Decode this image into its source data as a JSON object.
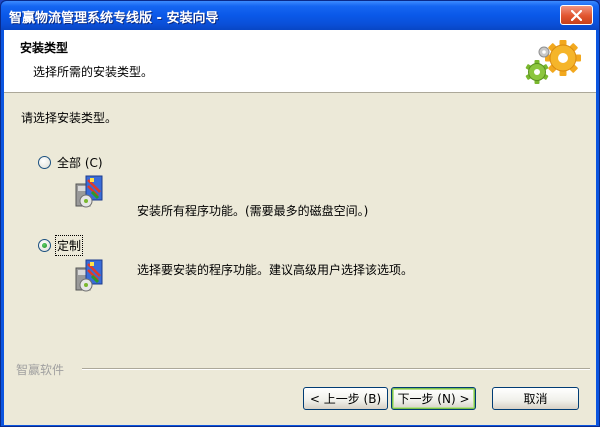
{
  "window": {
    "title": "智赢物流管理系统专线版 - 安装向导"
  },
  "header": {
    "title": "安装类型",
    "subtitle": "选择所需的安装类型。",
    "icon": "gears-icon"
  },
  "body": {
    "prompt": "请选择安装类型。",
    "options": [
      {
        "label": "全部 (C)",
        "selected": false,
        "description": "安装所有程序功能。(需要最多的磁盘空间。)",
        "icon": "package-icon"
      },
      {
        "label": "定制",
        "selected": true,
        "description": "选择要安装的程序功能。建议高级用户选择该选项。",
        "icon": "package-icon"
      }
    ]
  },
  "footer": {
    "brand": "智赢软件",
    "back_label": "< 上一步 (B)",
    "next_label": "下一步 (N) >",
    "cancel_label": "取消"
  },
  "colors": {
    "titlebar": "#0a58e8",
    "dialog_bg": "#ece9d8",
    "close_button": "#e2552f"
  }
}
